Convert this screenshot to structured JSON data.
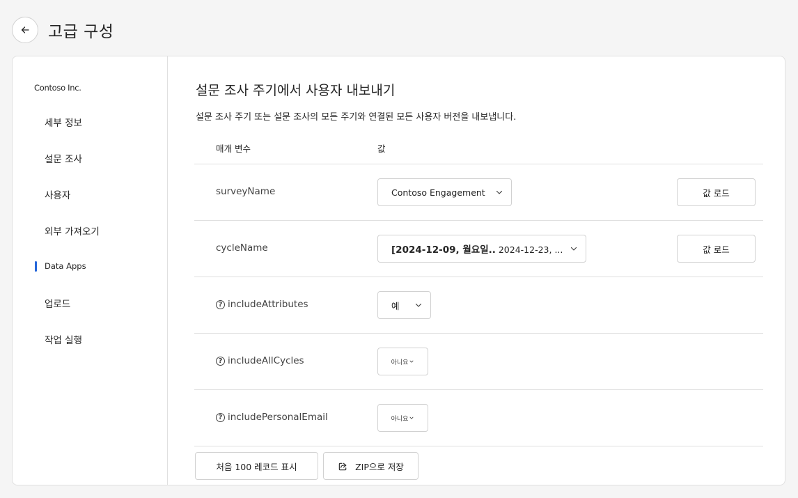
{
  "header": {
    "title": "고급 구성",
    "back_icon": "arrow-left-icon"
  },
  "sidebar": {
    "org": "Contoso Inc.",
    "items": [
      {
        "label": "세부 정보"
      },
      {
        "label": "설문 조사"
      },
      {
        "label": "사용자"
      },
      {
        "label": "외부 가져오기"
      },
      {
        "label": "Data Apps",
        "active": true
      },
      {
        "label": "업로드"
      },
      {
        "label": "작업 실행"
      }
    ]
  },
  "main": {
    "title": "설문 조사 주기에서 사용자 내보내기",
    "description": "설문 조사 주기 또는 설문 조사의 모든 주기와 연결된 모든 사용자 버전을 내보냅니다.",
    "col_param": "매개 변수",
    "col_value": "값",
    "rows": [
      {
        "param": "surveyName",
        "value": "Contoso Engagement",
        "load_label": "값 로드"
      },
      {
        "param": "cycleName",
        "value_bold": "[2024-12-09, 월요일..",
        "value_rest": " 2024-12-23, ...",
        "load_label": "값 로드"
      },
      {
        "param": "includeAttributes",
        "value": "예"
      },
      {
        "param": "includeAllCycles",
        "value": "아니요"
      },
      {
        "param": "includePersonalEmail",
        "value": "아니요"
      }
    ],
    "footer": {
      "preview_label": "처음 100 레코드 표시",
      "save_zip_label": "ZIP으로 저장",
      "save_zip_icon": "share-icon"
    }
  },
  "colors": {
    "accent": "#2566d9",
    "border": "#d1d1d1",
    "background": "#f5f5f5"
  }
}
